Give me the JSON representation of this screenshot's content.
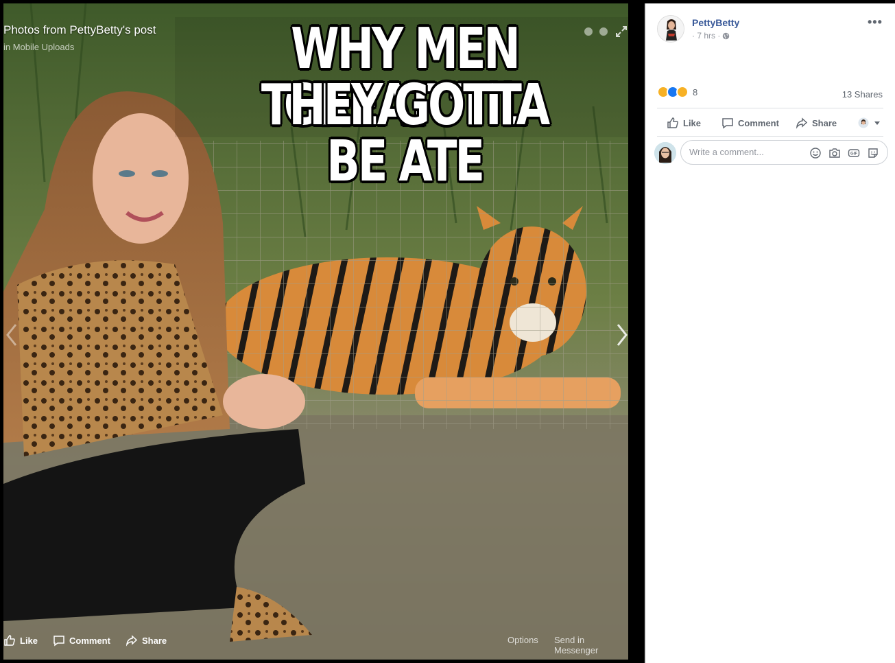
{
  "viewer": {
    "title": "Photos from PettyBetty's post",
    "album": "in Mobile Uploads",
    "meme_line_1": "WHY MEN GREAT 'TIL",
    "meme_line_2": "THEY GOTTA BE ATE",
    "actions": {
      "like": "Like",
      "comment": "Comment",
      "share": "Share",
      "options": "Options",
      "send_in_messenger": "Send in Messenger"
    }
  },
  "post": {
    "author": "PettyBetty",
    "time": "· 7 hrs ·",
    "reaction_count": "8",
    "shares": "13 Shares",
    "actions": {
      "like": "Like",
      "comment": "Comment",
      "share": "Share"
    },
    "comment_placeholder": "Write a comment..."
  },
  "colors": {
    "link_blue": "#385898",
    "meta_gray": "#90949c",
    "action_gray": "#606770",
    "haha_yellow": "#f7b125",
    "like_blue": "#1877f2"
  },
  "icons": [
    "expand-icon",
    "globe-icon",
    "more-icon",
    "like-icon",
    "comment-icon",
    "share-icon",
    "emoji-icon",
    "camera-icon",
    "gif-icon",
    "sticker-icon"
  ]
}
